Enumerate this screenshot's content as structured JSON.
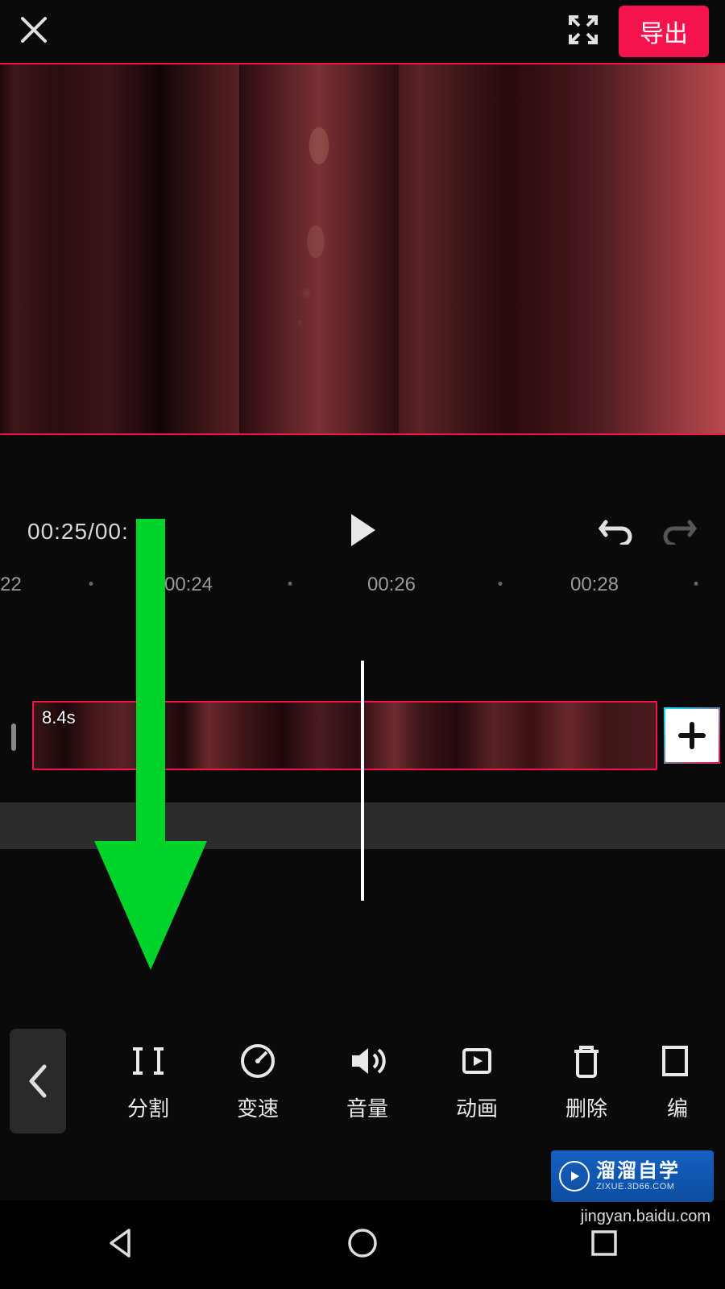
{
  "header": {
    "export_label": "导出"
  },
  "playback": {
    "timecode": "00:25/00:",
    "ruler": [
      {
        "label": "22",
        "pos": 1.5
      },
      {
        "label": "00:24",
        "pos": 26
      },
      {
        "label": "00:26",
        "pos": 54
      },
      {
        "label": "00:28",
        "pos": 82
      }
    ],
    "ruler_dots": [
      12.5,
      40,
      69,
      96
    ]
  },
  "timeline": {
    "clip_duration": "8.4s"
  },
  "tools": [
    {
      "id": "split",
      "label": "分割"
    },
    {
      "id": "speed",
      "label": "变速"
    },
    {
      "id": "volume",
      "label": "音量"
    },
    {
      "id": "anim",
      "label": "动画"
    },
    {
      "id": "delete",
      "label": "删除"
    },
    {
      "id": "edit",
      "label": "编"
    }
  ],
  "watermark": {
    "main": "溜溜自学",
    "sub": "ZIXUE.3D66.COM"
  },
  "credit": "jingyan.baidu.com",
  "colors": {
    "accent": "#f5134d",
    "arrow": "#00d42a"
  }
}
